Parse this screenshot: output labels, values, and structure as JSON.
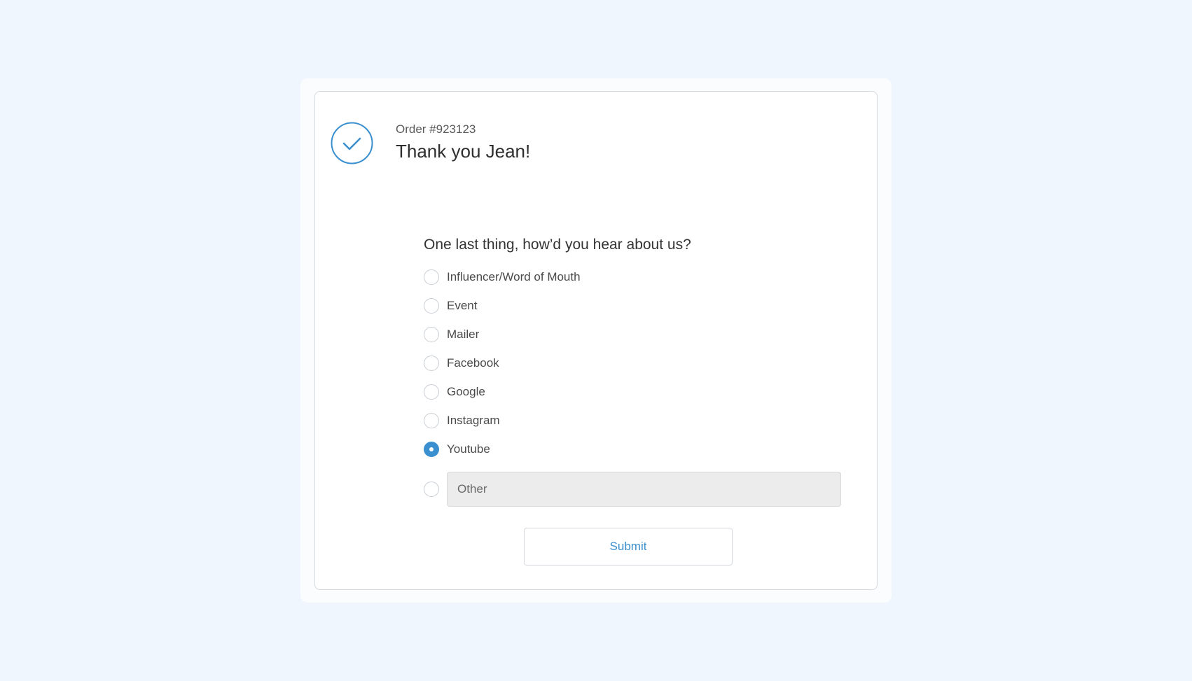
{
  "order": {
    "number_label": "Order #923123",
    "thank_you": "Thank you Jean!"
  },
  "colors": {
    "accent": "#3a8fcf",
    "background": "#f0f6fd",
    "card": "#ffffff",
    "input_fill": "#ececec"
  },
  "icons": {
    "confirmation": "check-circle-icon"
  },
  "survey": {
    "question": "One last thing, how’d you hear about us?",
    "options": [
      {
        "label": "Influencer/Word of Mouth",
        "selected": false
      },
      {
        "label": "Event",
        "selected": false
      },
      {
        "label": "Mailer",
        "selected": false
      },
      {
        "label": "Facebook",
        "selected": false
      },
      {
        "label": "Google",
        "selected": false
      },
      {
        "label": "Instagram",
        "selected": false
      },
      {
        "label": "Youtube",
        "selected": true
      }
    ],
    "other": {
      "placeholder": "Other",
      "value": "",
      "selected": false
    },
    "submit_label": "Submit"
  }
}
